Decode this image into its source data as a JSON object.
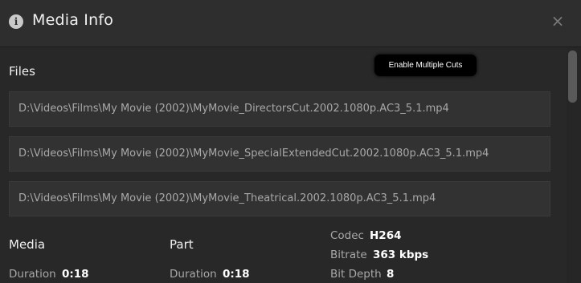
{
  "header": {
    "title": "Media Info",
    "info_icon": "i",
    "close_icon": "×"
  },
  "tooltip": {
    "text": "Enable Multiple Cuts"
  },
  "files": {
    "heading": "Files",
    "items": [
      "D:\\Videos\\Films\\My Movie (2002)\\MyMovie_DirectorsCut.2002.1080p.AC3_5.1.mp4",
      "D:\\Videos\\Films\\My Movie (2002)\\MyMovie_SpecialExtendedCut.2002.1080p.AC3_5.1.mp4",
      "D:\\Videos\\Films\\My Movie (2002)\\MyMovie_Theatrical.2002.1080p.AC3_5.1.mp4"
    ]
  },
  "media": {
    "heading": "Media",
    "duration_label": "Duration",
    "duration_value": "0:18"
  },
  "part": {
    "heading": "Part",
    "duration_label": "Duration",
    "duration_value": "0:18"
  },
  "stream": {
    "codec_label": "Codec",
    "codec_value": "H264",
    "bitrate_label": "Bitrate",
    "bitrate_value": "363 kbps",
    "bitdepth_label": "Bit Depth",
    "bitdepth_value": "8"
  },
  "colors": {
    "background": "#282828",
    "header": "#2e2e2e",
    "file_row": "#323232",
    "tooltip": "#000000"
  }
}
